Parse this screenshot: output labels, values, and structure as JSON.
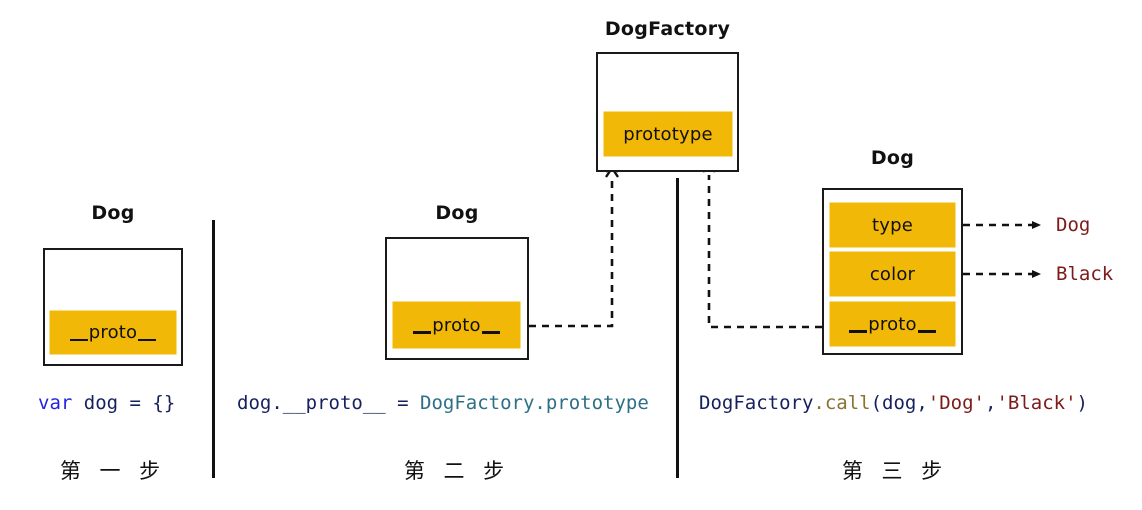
{
  "diagram": {
    "title_step1_box": "Dog",
    "title_step2_box": "Dog",
    "title_step3_box": "Dog",
    "title_factory_box": "DogFactory"
  },
  "boxes": {
    "step1_dog": {
      "label": "Dog",
      "slots": [
        {
          "name": "__proto__",
          "text": "proto"
        }
      ]
    },
    "step2_dog": {
      "label": "Dog",
      "slots": [
        {
          "name": "__proto__",
          "text": "proto"
        }
      ]
    },
    "dog_factory": {
      "label": "DogFactory",
      "slots": [
        {
          "name": "prototype",
          "text": "prototype"
        }
      ]
    },
    "step3_dog": {
      "label": "Dog",
      "slots": [
        {
          "name": "type",
          "text": "type"
        },
        {
          "name": "color",
          "text": "color"
        },
        {
          "name": "__proto__",
          "text": "proto"
        }
      ]
    }
  },
  "values": {
    "type_value": "Dog",
    "color_value": "Black"
  },
  "code": {
    "step1": [
      {
        "t": "var",
        "c": "kw"
      },
      {
        "t": " dog = {}",
        "c": "plain"
      }
    ],
    "step2": [
      {
        "t": "dog.__proto__ = ",
        "c": "plain"
      },
      {
        "t": "DogFactory.prototype",
        "c": "obj"
      }
    ],
    "step3": [
      {
        "t": "DogFactory",
        "c": "plain"
      },
      {
        "t": ".call",
        "c": "fn"
      },
      {
        "t": "(dog,",
        "c": "plain"
      },
      {
        "t": "'Dog'",
        "c": "str"
      },
      {
        "t": ",",
        "c": "plain"
      },
      {
        "t": "'Black'",
        "c": "str"
      },
      {
        "t": ")",
        "c": "plain"
      }
    ]
  },
  "steps": {
    "step1_label": "第 一 步",
    "step2_label": "第 二 步",
    "step3_label": "第 三 步"
  },
  "colors": {
    "slot_yellow": "#F2B808",
    "ink": "#111111",
    "code_keyword": "#2525dd",
    "code_plain": "#16205c",
    "code_object": "#2c6f86",
    "code_function": "#8a7233",
    "code_string": "#7d1a1a",
    "value_red": "#7d1a1a",
    "background": "#ffffff"
  }
}
